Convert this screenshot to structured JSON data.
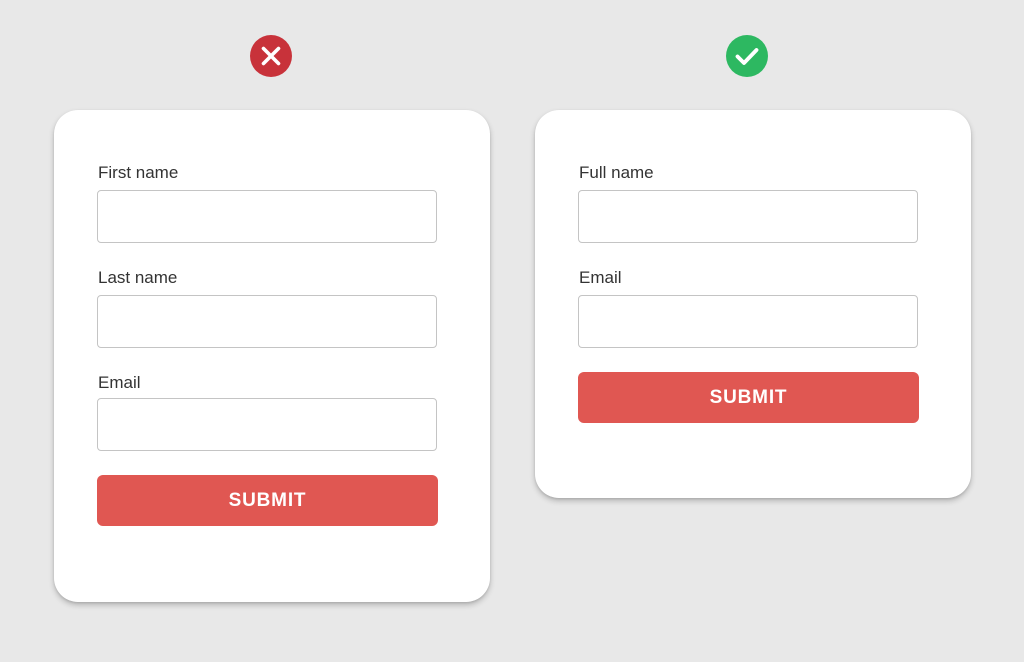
{
  "colors": {
    "background": "#e8e8e8",
    "card": "#ffffff",
    "accent_red": "#e05752",
    "error_icon": "#c8323a",
    "success_icon": "#2db861"
  },
  "bad_example": {
    "icon": "x-circle-icon",
    "fields": [
      {
        "label": "First name",
        "value": "",
        "placeholder": ""
      },
      {
        "label": "Last name",
        "value": "",
        "placeholder": ""
      },
      {
        "label": "Email",
        "value": "",
        "placeholder": ""
      }
    ],
    "submit_label": "SUBMIT"
  },
  "good_example": {
    "icon": "check-circle-icon",
    "fields": [
      {
        "label": "Full name",
        "value": "",
        "placeholder": ""
      },
      {
        "label": "Email",
        "value": "",
        "placeholder": ""
      }
    ],
    "submit_label": "SUBMIT"
  }
}
